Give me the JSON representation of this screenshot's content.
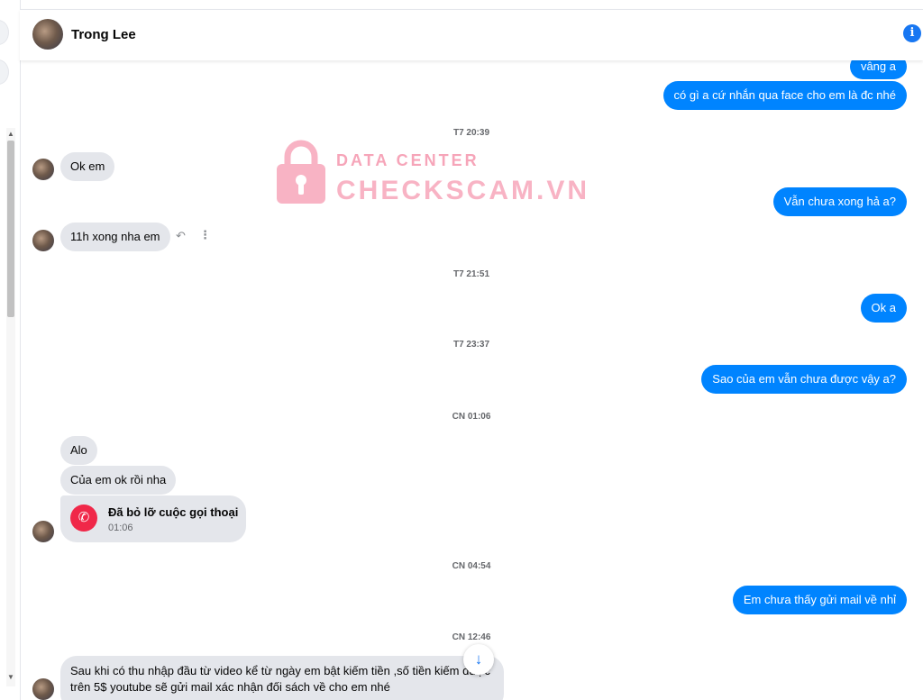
{
  "header": {
    "contact_name": "Trong Lee",
    "info_icon": "info-icon"
  },
  "watermark": {
    "line1": "DATA CENTER",
    "line2": "CHECKSCAM.VN",
    "color": "#f8b3c4"
  },
  "colors": {
    "outgoing": "#0084ff",
    "incoming": "#e4e6eb",
    "missed_call": "#f02849",
    "accent": "#1877f2"
  },
  "messages": {
    "out_1": "vâng a",
    "out_2": "có gì a cứ nhắn qua face cho em là đc nhé",
    "ts_1": "T7 20:39",
    "in_1": "Ok em",
    "out_3": "Vẫn chưa xong hả a?",
    "in_2": "11h xong nha em",
    "ts_2": "T7 21:51",
    "out_4": "Ok a",
    "ts_3": "T7 23:37",
    "out_5": "Sao của em vẫn chưa được vậy a?",
    "ts_4": "CN 01:06",
    "in_3": "Alo",
    "in_4": "Của em ok rồi nha",
    "call_title": "Đã bỏ lỡ cuộc gọi thoại",
    "call_time": "01:06",
    "ts_5": "CN 04:54",
    "out_6": "Em chưa thấy gửi mail về nhỉ",
    "ts_6": "CN 12:46",
    "in_5": "Sau khi có thu nhập đầu từ video kể từ ngày em bật kiếm tiền ,số tiền kiếm được trên 5$ youtube sẽ gửi mail xác nhận đối sách về cho em nhé"
  }
}
